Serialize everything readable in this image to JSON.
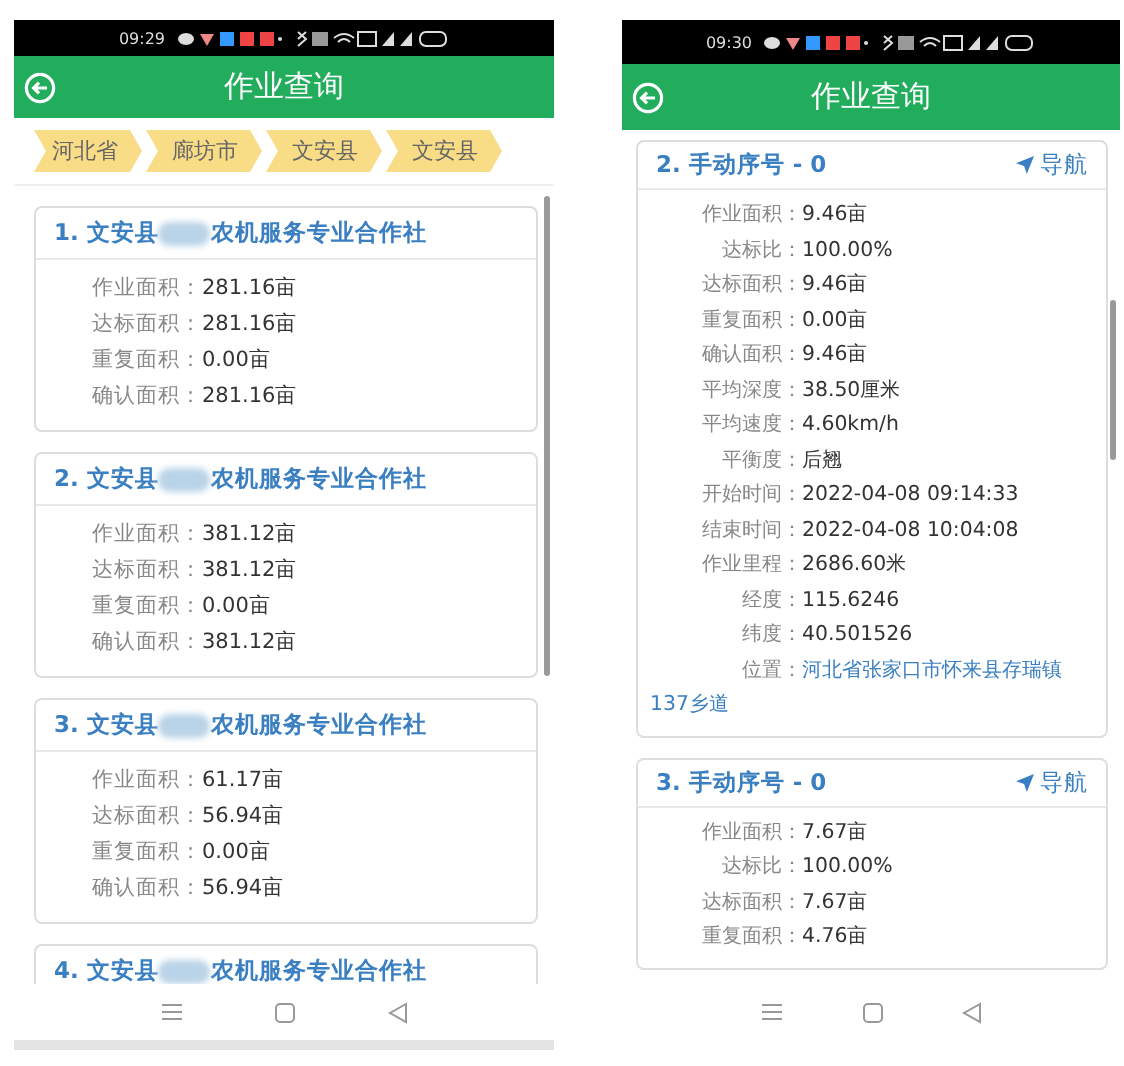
{
  "phones": [
    {
      "status_bar": {
        "time": "09:29"
      },
      "header": {
        "title": "作业查询"
      },
      "breadcrumb": [
        "河北省",
        "廊坊市",
        "文安县",
        "文安县"
      ],
      "cards": [
        {
          "title": "1. 文安县",
          "title_after": "农机服务专业合作社",
          "redacted": true,
          "rows": [
            {
              "label": "作业面积：",
              "value": "281.16亩",
              "kind": "text"
            },
            {
              "label": "达标面积：",
              "value": "281.16亩",
              "kind": "text"
            },
            {
              "label": "重复面积：",
              "value": "0.00亩",
              "kind": "text"
            },
            {
              "label": "确认面积：",
              "value": "281.16亩",
              "kind": "text"
            }
          ]
        },
        {
          "title": "2. 文安县",
          "title_after": "农机服务专业合作社",
          "redacted": true,
          "rows": [
            {
              "label": "作业面积：",
              "value": "381.12亩",
              "kind": "text"
            },
            {
              "label": "达标面积：",
              "value": "381.12亩",
              "kind": "text"
            },
            {
              "label": "重复面积：",
              "value": "0.00亩",
              "kind": "text"
            },
            {
              "label": "确认面积：",
              "value": "381.12亩",
              "kind": "text"
            }
          ]
        },
        {
          "title": "3. 文安县",
          "title_after": "农机服务专业合作社",
          "redacted": true,
          "rows": [
            {
              "label": "作业面积：",
              "value": "61.17亩",
              "kind": "text"
            },
            {
              "label": "达标面积：",
              "value": "56.94亩",
              "kind": "text"
            },
            {
              "label": "重复面积：",
              "value": "0.00亩",
              "kind": "text"
            },
            {
              "label": "确认面积：",
              "value": "56.94亩",
              "kind": "text"
            }
          ]
        },
        {
          "title": "4. 文安县",
          "title_after": "农机服务专业合作社",
          "redacted": true
        }
      ]
    },
    {
      "status_bar": {
        "time": "09:30"
      },
      "header": {
        "title": "作业查询"
      },
      "cards": [
        {
          "title": "2. 手动序号 - 0",
          "nav": "导航",
          "rows": [
            {
              "label": "作业面积：",
              "value": "9.46亩",
              "kind": "text"
            },
            {
              "label": "达标比：",
              "value": "100.00%",
              "kind": "text"
            },
            {
              "label": "达标面积：",
              "value": "9.46亩",
              "kind": "text"
            },
            {
              "label": "重复面积：",
              "value": "0.00亩",
              "kind": "text"
            },
            {
              "label": "确认面积：",
              "value": "9.46亩",
              "kind": "text"
            },
            {
              "label": "平均深度：",
              "value": "38.50厘米",
              "kind": "text"
            },
            {
              "label": "平均速度：",
              "value": "4.60km/h",
              "kind": "text"
            },
            {
              "label": "平衡度：",
              "value": "后翘",
              "kind": "text"
            },
            {
              "label": "开始时间：",
              "value": "2022-04-08 09:14:33",
              "kind": "text"
            },
            {
              "label": "结束时间：",
              "value": "2022-04-08 10:04:08",
              "kind": "text"
            },
            {
              "label": "作业里程：",
              "value": "2686.60米",
              "kind": "text"
            },
            {
              "label": "经度：",
              "value": "115.6246",
              "kind": "text"
            },
            {
              "label": "纬度：",
              "value": "40.501526",
              "kind": "text"
            },
            {
              "label": "位置：",
              "value": "河北省张家口市怀来县存瑞镇137乡道",
              "kind": "link"
            }
          ]
        },
        {
          "title": "3. 手动序号 - 0",
          "nav": "导航",
          "rows": [
            {
              "label": "作业面积：",
              "value": "7.67亩",
              "kind": "text"
            },
            {
              "label": "达标比：",
              "value": "100.00%",
              "kind": "text"
            },
            {
              "label": "达标面积：",
              "value": "7.67亩",
              "kind": "text"
            },
            {
              "label": "重复面积：",
              "value": "4.76亩",
              "kind": "text"
            }
          ]
        }
      ]
    }
  ]
}
